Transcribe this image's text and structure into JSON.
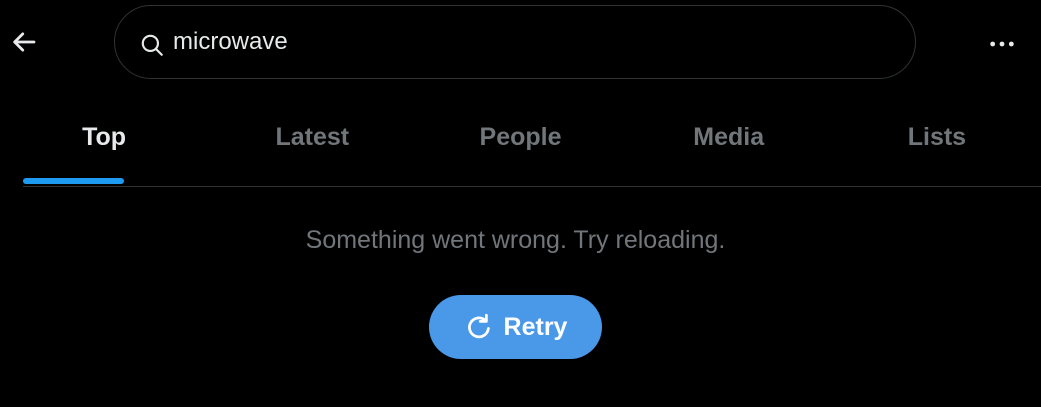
{
  "header": {
    "back_icon": "arrow-left-icon",
    "search": {
      "icon": "search-icon",
      "value": "microwave",
      "placeholder": "Search"
    },
    "more_icon": "more-horizontal-icon"
  },
  "tabs": [
    {
      "label": "Top",
      "active": true
    },
    {
      "label": "Latest",
      "active": false
    },
    {
      "label": "People",
      "active": false
    },
    {
      "label": "Media",
      "active": false
    },
    {
      "label": "Lists",
      "active": false
    }
  ],
  "error": {
    "message": "Something went wrong. Try reloading."
  },
  "retry": {
    "icon": "refresh-icon",
    "label": "Retry"
  },
  "colors": {
    "background": "#000000",
    "accent": "#1d9bf0",
    "button": "#4a99e9",
    "text_primary": "#e7e9ea",
    "text_secondary": "#71767b",
    "border": "#2f3336"
  }
}
